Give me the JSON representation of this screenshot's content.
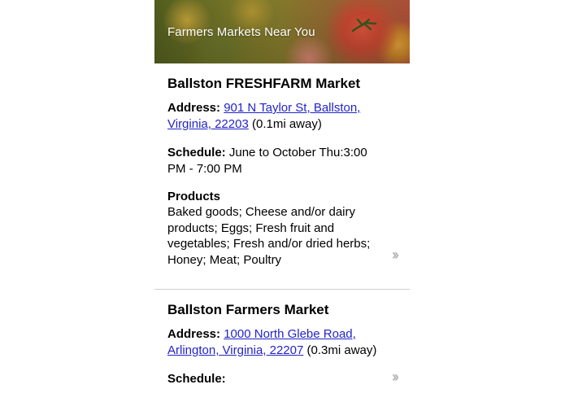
{
  "header": {
    "title": "Farmers Markets Near You"
  },
  "markets": [
    {
      "name": "Ballston FRESHFARM Market",
      "address_label": "Address:",
      "address_link": "901 N Taylor St, Ballston, Virginia, 22203",
      "address_link_line1": "901 N Taylor St, Ballston,",
      "address_link_line2": "Virginia, 22203",
      "distance": "(0.1mi away)",
      "schedule_label": "Schedule:",
      "schedule": "June to October Thu:3:00 PM - 7:00 PM",
      "products_label": "Products",
      "products": "Baked goods; Cheese and/or dairy products; Eggs; Fresh fruit and vegetables; Fresh and/or dried herbs; Honey; Meat; Poultry",
      "chevron_icon": "double-chevron-right-icon"
    },
    {
      "name": "Ballston Farmers Market",
      "address_label": "Address:",
      "address_link": "1000 North Glebe Road, Arlington, Virginia, 22207",
      "address_link_line1": "1000 North Glebe Road,",
      "address_link_line2": "Arlington, Virginia, 22207",
      "distance": "(0.3mi away)",
      "schedule_label": "Schedule:",
      "chevron_icon": "double-chevron-right-icon"
    }
  ],
  "colors": {
    "link": "#2323c9",
    "divider": "#cfcfcf",
    "chevron": "#b5b5b5"
  }
}
